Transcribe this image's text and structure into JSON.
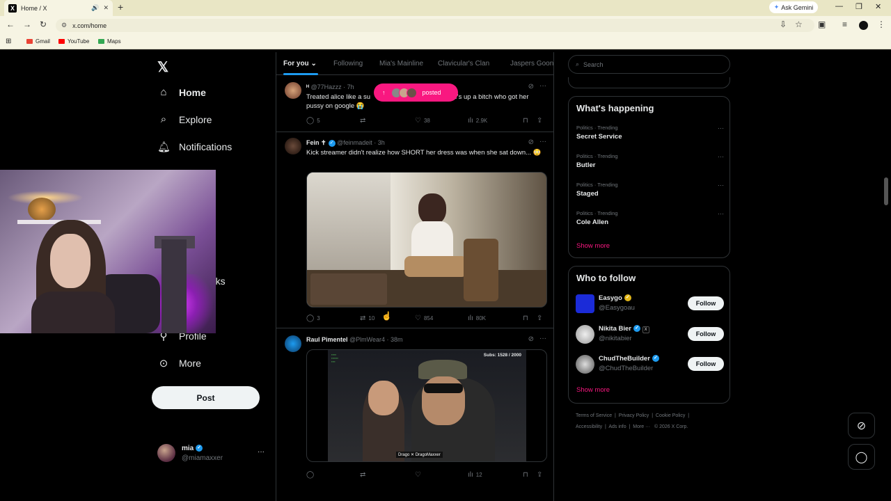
{
  "browser": {
    "tab_title": "Home / X",
    "new_tab": "+",
    "gemini_label": "Ask Gemini",
    "url": "x.com/home",
    "bookmarks": [
      {
        "label": "Gmail",
        "color": "#ea4335"
      },
      {
        "label": "YouTube",
        "color": "#ff0000"
      },
      {
        "label": "Maps",
        "color": "#34a853"
      }
    ]
  },
  "nav": {
    "home": "Home",
    "explore": "Explore",
    "notifications": "Notifications",
    "bookmarks_fragment": "rks",
    "profile": "Profile",
    "more": "More",
    "post_button": "Post"
  },
  "account": {
    "name": "mia",
    "handle": "@miamaxxer"
  },
  "feed": {
    "tabs": [
      "For you",
      "Following",
      "Mia's Mainline",
      "Clavicular's Clan",
      "Jaspers Goon"
    ],
    "posted_pill": "posted",
    "tweets": [
      {
        "name": "ᴴ",
        "handle": "@77Hazzz",
        "time": "7h",
        "text": "Treated alice like a su",
        "text2": "out wife's up a bitch who got her pussy on google 😭",
        "replies": "5",
        "retweets": "",
        "likes": "38",
        "views": "2.9K"
      },
      {
        "name": "Fein ✝",
        "handle": "@feinmadeit",
        "time": "3h",
        "text": "Kick streamer didn't realize how SHORT her dress was when she sat down... 😳",
        "replies": "3",
        "retweets": "10",
        "likes": "854",
        "views": "80K"
      },
      {
        "name": "Raul Pimentel",
        "handle": "@PlmWear4",
        "time": "38m",
        "media_overlay_top": "Subs: 1528 / 2000",
        "media_overlay_bottom": "Drago ✕ DragoMaxxer",
        "replies": "",
        "retweets": "",
        "likes": "",
        "views": "12"
      }
    ]
  },
  "right": {
    "search_placeholder": "Search",
    "happening_title": "What's happening",
    "trends": [
      {
        "context": "Politics · Trending",
        "topic": "Secret Service"
      },
      {
        "context": "Politics · Trending",
        "topic": "Butler"
      },
      {
        "context": "Politics · Trending",
        "topic": "Staged"
      },
      {
        "context": "Politics · Trending",
        "topic": "Cole Allen"
      }
    ],
    "show_more": "Show more",
    "who_title": "Who to follow",
    "follow_label": "Follow",
    "suggestions": [
      {
        "name": "Easygo",
        "handle": "@Easygoau"
      },
      {
        "name": "Nikita Bier",
        "handle": "@nikitabier"
      },
      {
        "name": "ChudTheBuilder",
        "handle": "@ChudTheBuilder"
      }
    ],
    "footer": [
      "Terms of Service",
      "Privacy Policy",
      "Cookie Policy",
      "Accessibility",
      "Ads info",
      "More ···",
      "© 2026 X Corp."
    ]
  },
  "colors": {
    "accent": "#1d9bf0",
    "pink": "#f91880",
    "background": "#000000"
  }
}
